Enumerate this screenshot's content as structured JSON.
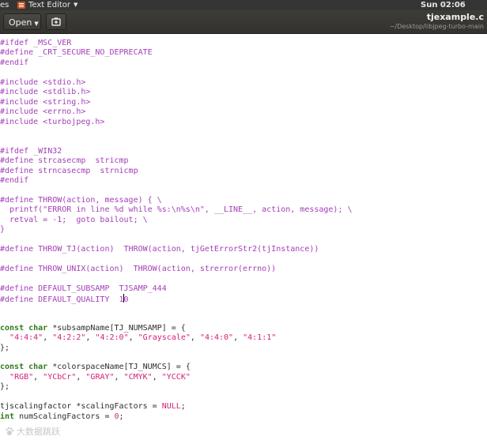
{
  "top_panel": {
    "activities": "es",
    "app_name": "Text Editor",
    "clock": "Sun 02:06"
  },
  "header": {
    "open_label": "Open",
    "file_name": "tjexample.c",
    "file_path": "~/Desktop/libjpeg-turbo-main"
  },
  "code_lines": [
    [
      {
        "t": "#ifdef _MSC_VER",
        "c": "pp"
      }
    ],
    [
      {
        "t": "#define _CRT_SECURE_NO_DEPRECATE",
        "c": "pp"
      }
    ],
    [
      {
        "t": "#endif",
        "c": "pp"
      }
    ],
    [],
    [
      {
        "t": "#include <stdio.h>",
        "c": "pp"
      }
    ],
    [
      {
        "t": "#include <stdlib.h>",
        "c": "pp"
      }
    ],
    [
      {
        "t": "#include <string.h>",
        "c": "pp"
      }
    ],
    [
      {
        "t": "#include <errno.h>",
        "c": "pp"
      }
    ],
    [
      {
        "t": "#include <turbojpeg.h>",
        "c": "pp"
      }
    ],
    [],
    [],
    [
      {
        "t": "#ifdef _WIN32",
        "c": "pp"
      }
    ],
    [
      {
        "t": "#define strcasecmp  stricmp",
        "c": "pp"
      }
    ],
    [
      {
        "t": "#define strncasecmp  strnicmp",
        "c": "pp"
      }
    ],
    [
      {
        "t": "#endif",
        "c": "pp"
      }
    ],
    [],
    [
      {
        "t": "#define THROW(action, message) { \\",
        "c": "pp"
      }
    ],
    [
      {
        "t": "  printf(\"ERROR in line %d while %s:\\n%s\\n\", __LINE__, action, message); \\",
        "c": "pp"
      }
    ],
    [
      {
        "t": "  retval = -1;  goto bailout; \\",
        "c": "pp"
      }
    ],
    [
      {
        "t": "}",
        "c": "pp"
      }
    ],
    [],
    [
      {
        "t": "#define THROW_TJ(action)  THROW(action, tjGetErrorStr2(tjInstance))",
        "c": "pp"
      }
    ],
    [],
    [
      {
        "t": "#define THROW_UNIX(action)  THROW(action, strerror(errno))",
        "c": "pp"
      }
    ],
    [],
    [
      {
        "t": "#define DEFAULT_SUBSAMP  TJSAMP_444",
        "c": "pp"
      }
    ],
    [
      {
        "t": "#define DEFAULT_QUALITY  1",
        "c": "pp"
      },
      {
        "cursor": true
      },
      {
        "t": "0",
        "c": "pp"
      }
    ],
    [],
    [],
    [
      {
        "t": "const char",
        "c": "kw"
      },
      {
        "t": " *subsampName[TJ_NUMSAMP] = {"
      }
    ],
    [
      {
        "t": "  "
      },
      {
        "t": "\"4:4:4\"",
        "c": "str"
      },
      {
        "t": ", "
      },
      {
        "t": "\"4:2:2\"",
        "c": "str"
      },
      {
        "t": ", "
      },
      {
        "t": "\"4:2:0\"",
        "c": "str"
      },
      {
        "t": ", "
      },
      {
        "t": "\"Grayscale\"",
        "c": "str"
      },
      {
        "t": ", "
      },
      {
        "t": "\"4:4:0\"",
        "c": "str"
      },
      {
        "t": ", "
      },
      {
        "t": "\"4:1:1\"",
        "c": "str"
      }
    ],
    [
      {
        "t": "};"
      }
    ],
    [],
    [
      {
        "t": "const char",
        "c": "kw"
      },
      {
        "t": " *colorspaceName[TJ_NUMCS] = {"
      }
    ],
    [
      {
        "t": "  "
      },
      {
        "t": "\"RGB\"",
        "c": "str"
      },
      {
        "t": ", "
      },
      {
        "t": "\"YCbCr\"",
        "c": "str"
      },
      {
        "t": ", "
      },
      {
        "t": "\"GRAY\"",
        "c": "str"
      },
      {
        "t": ", "
      },
      {
        "t": "\"CMYK\"",
        "c": "str"
      },
      {
        "t": ", "
      },
      {
        "t": "\"YCCK\"",
        "c": "str"
      }
    ],
    [
      {
        "t": "};"
      }
    ],
    [],
    [
      {
        "t": "tjscalingfactor *scalingFactors = "
      },
      {
        "t": "NULL",
        "c": "num"
      },
      {
        "t": ";"
      }
    ],
    [
      {
        "t": "int",
        "c": "kw"
      },
      {
        "t": " numScalingFactors = "
      },
      {
        "t": "0",
        "c": "num"
      },
      {
        "t": ";"
      }
    ]
  ],
  "watermark": "大数据跳跃"
}
